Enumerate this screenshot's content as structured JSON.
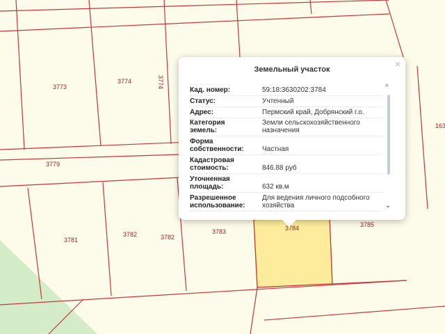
{
  "map": {
    "plot_numbers": {
      "p3773": "3773",
      "p3774": "3774",
      "p3774_vertical": "3774",
      "p3779": "3779",
      "p3781": "3781",
      "p3782a": "3782",
      "p3782b": "3782",
      "p3783": "3783",
      "p3784": "3784",
      "p3785": "3785",
      "p163": "163"
    },
    "colors": {
      "background": "#fdfbe9",
      "boundary": "#c8353b",
      "selected_fill": "#fcec9c",
      "selected_border": "#e0c44a",
      "green_area": "#d5ecc9",
      "label": "#9b1e1e"
    }
  },
  "popup": {
    "title": "Земельный участок",
    "close_glyph": "×",
    "scroll_up_glyph": "^",
    "scroll_down_glyph": "⌄",
    "rows": [
      {
        "label": "Кад. номер:",
        "value": "59:18:3630202:3784"
      },
      {
        "label": "Статус:",
        "value": "Учтенный"
      },
      {
        "label": "Адрес:",
        "value": "Пермский край, Добрянский г.о."
      },
      {
        "label_lines": [
          "Категория",
          "земель:"
        ],
        "value_lines": [
          "Земли сельскохозяйственного",
          "назначения"
        ]
      },
      {
        "label_lines": [
          "Форма",
          "собственности:"
        ],
        "value": "Частная"
      },
      {
        "label_lines": [
          "Кадастровая",
          "стоимость:"
        ],
        "value": "846.88 руб"
      },
      {
        "label_lines": [
          "Уточненная",
          "площадь:"
        ],
        "value": "632 кв.м"
      },
      {
        "label_lines": [
          "Разрешенное",
          "использование:"
        ],
        "value_lines": [
          "Для ведения личного подсобного",
          "хозяйства"
        ]
      }
    ]
  }
}
